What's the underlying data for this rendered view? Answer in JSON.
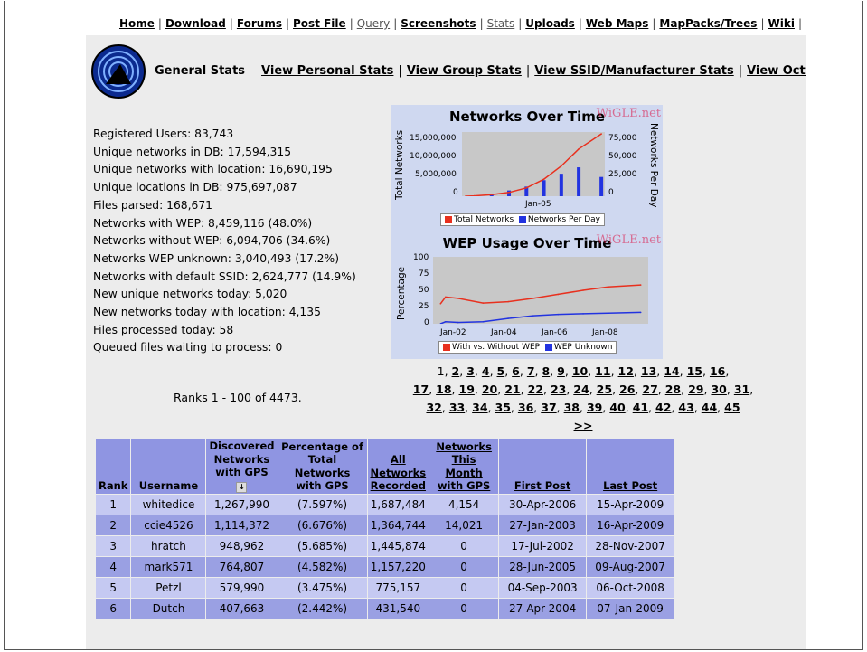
{
  "nav": {
    "items": [
      {
        "label": "Home",
        "dim": false
      },
      {
        "label": "Download",
        "dim": false
      },
      {
        "label": "Forums",
        "dim": false
      },
      {
        "label": "Post File",
        "dim": false
      },
      {
        "label": "Query",
        "dim": true
      },
      {
        "label": "Screenshots",
        "dim": false
      },
      {
        "label": "Stats",
        "dim": true
      },
      {
        "label": "Uploads",
        "dim": false
      },
      {
        "label": "Web Maps",
        "dim": false
      },
      {
        "label": "MapPacks/Trees",
        "dim": false
      },
      {
        "label": "Wiki",
        "dim": false
      }
    ]
  },
  "subnav": {
    "current": "General Stats",
    "links": [
      "View Personal Stats",
      "View Group Stats",
      "View SSID/Manufacturer Stats",
      "View Octet/Chan"
    ]
  },
  "stats": [
    "Registered Users: 83,743",
    "Unique networks in DB: 17,594,315",
    "Unique networks with location: 16,690,195",
    "Unique locations in DB: 975,697,087",
    "Files parsed: 168,671",
    "Networks with WEP: 8,459,116 (48.0%)",
    "Networks without WEP: 6,094,706 (34.6%)",
    "Networks WEP unknown: 3,040,493 (17.2%)",
    "Networks with default SSID: 2,624,777 (14.9%)",
    "New unique networks today: 5,020",
    "New networks today with location: 4,135",
    "Files processed today: 58",
    "Queued files waiting to process: 0"
  ],
  "chart_data": [
    {
      "type": "line",
      "title": "Networks Over Time",
      "watermark": "WiGLE.net",
      "ylabel": "Total Networks",
      "y2label": "Networks Per Day",
      "yticks": [
        "15,000,000",
        "10,000,000",
        "5,000,000",
        "0"
      ],
      "y2ticks": [
        "75,000",
        "50,000",
        "25,000",
        "0"
      ],
      "xticks": [
        "Jan-05"
      ],
      "ylim": [
        0,
        17000000
      ],
      "y2lim": [
        0,
        100000
      ],
      "colors": {
        "total": "#e8301e",
        "perday": "#2233e0"
      },
      "series": [
        {
          "name": "Total Networks",
          "x": [
            2001.5,
            2002,
            2003,
            2004,
            2005,
            2006,
            2007,
            2008,
            2009.3
          ],
          "values": [
            0,
            100000,
            400000,
            1000000,
            2200000,
            4500000,
            8000000,
            12500000,
            16500000
          ]
        },
        {
          "name": "Networks Per Day",
          "x": [
            2001.5,
            2002,
            2003,
            2004,
            2005,
            2006,
            2007,
            2008,
            2009.3
          ],
          "values": [
            0,
            800,
            2500,
            9000,
            15000,
            25000,
            35000,
            45000,
            30000
          ]
        }
      ]
    },
    {
      "type": "line",
      "title": "WEP Usage Over Time",
      "watermark": "WiGLE.net",
      "ylabel": "Percentage",
      "yticks": [
        "100",
        "75",
        "50",
        "25",
        "0"
      ],
      "xticks": [
        "Jan-02",
        "Jan-04",
        "Jan-06",
        "Jan-08"
      ],
      "ylim": [
        0,
        100
      ],
      "colors": {
        "with": "#e8301e",
        "unknown": "#2233e0"
      },
      "series": [
        {
          "name": "With vs. Without WEP",
          "x": [
            2001.3,
            2001.5,
            2002,
            2003,
            2004,
            2005,
            2006,
            2007,
            2008,
            2009.3
          ],
          "values": [
            30,
            40,
            38,
            31,
            33,
            38,
            44,
            50,
            55,
            58
          ]
        },
        {
          "name": "WEP Unknown",
          "x": [
            2001.3,
            2001.5,
            2002,
            2003,
            2004,
            2005,
            2006,
            2007,
            2008,
            2009.3
          ],
          "values": [
            0,
            3,
            2,
            3,
            8,
            12,
            14,
            15,
            16,
            17
          ]
        }
      ]
    }
  ],
  "ranks_label": "Ranks 1 - 100 of 4473.",
  "pages": {
    "current": "1",
    "links": [
      "2",
      "3",
      "4",
      "5",
      "6",
      "7",
      "8",
      "9",
      "10",
      "11",
      "12",
      "13",
      "14",
      "15",
      "16",
      "17",
      "18",
      "19",
      "20",
      "21",
      "22",
      "23",
      "24",
      "25",
      "26",
      "27",
      "28",
      "29",
      "30",
      "31",
      "32",
      "33",
      "34",
      "35",
      "36",
      "37",
      "38",
      "39",
      "40",
      "41",
      "42",
      "43",
      "44",
      "45"
    ],
    "next": ">>"
  },
  "table": {
    "headers": {
      "rank": "Rank",
      "username": "Username",
      "discovered": "Discovered Networks with GPS",
      "percentage": "Percentage of Total Networks with GPS",
      "all": "All Networks Recorded",
      "month": "Networks This Month with GPS",
      "first": "First Post",
      "last": "Last Post"
    },
    "rows": [
      {
        "rank": "1",
        "username": "whitedice",
        "gps": "1,267,990",
        "pct": "(7.597%)",
        "all": "1,687,484",
        "month": "4,154",
        "first": "30-Apr-2006",
        "last": "15-Apr-2009"
      },
      {
        "rank": "2",
        "username": "ccie4526",
        "gps": "1,114,372",
        "pct": "(6.676%)",
        "all": "1,364,744",
        "month": "14,021",
        "first": "27-Jan-2003",
        "last": "16-Apr-2009"
      },
      {
        "rank": "3",
        "username": "hratch",
        "gps": "948,962",
        "pct": "(5.685%)",
        "all": "1,445,874",
        "month": "0",
        "first": "17-Jul-2002",
        "last": "28-Nov-2007"
      },
      {
        "rank": "4",
        "username": "mark571",
        "gps": "764,807",
        "pct": "(4.582%)",
        "all": "1,157,220",
        "month": "0",
        "first": "28-Jun-2005",
        "last": "09-Aug-2007"
      },
      {
        "rank": "5",
        "username": "Petzl",
        "gps": "579,990",
        "pct": "(3.475%)",
        "all": "775,157",
        "month": "0",
        "first": "04-Sep-2003",
        "last": "06-Oct-2008"
      },
      {
        "rank": "6",
        "username": "Dutch",
        "gps": "407,663",
        "pct": "(2.442%)",
        "all": "431,540",
        "month": "0",
        "first": "27-Apr-2004",
        "last": "07-Jan-2009"
      }
    ]
  }
}
